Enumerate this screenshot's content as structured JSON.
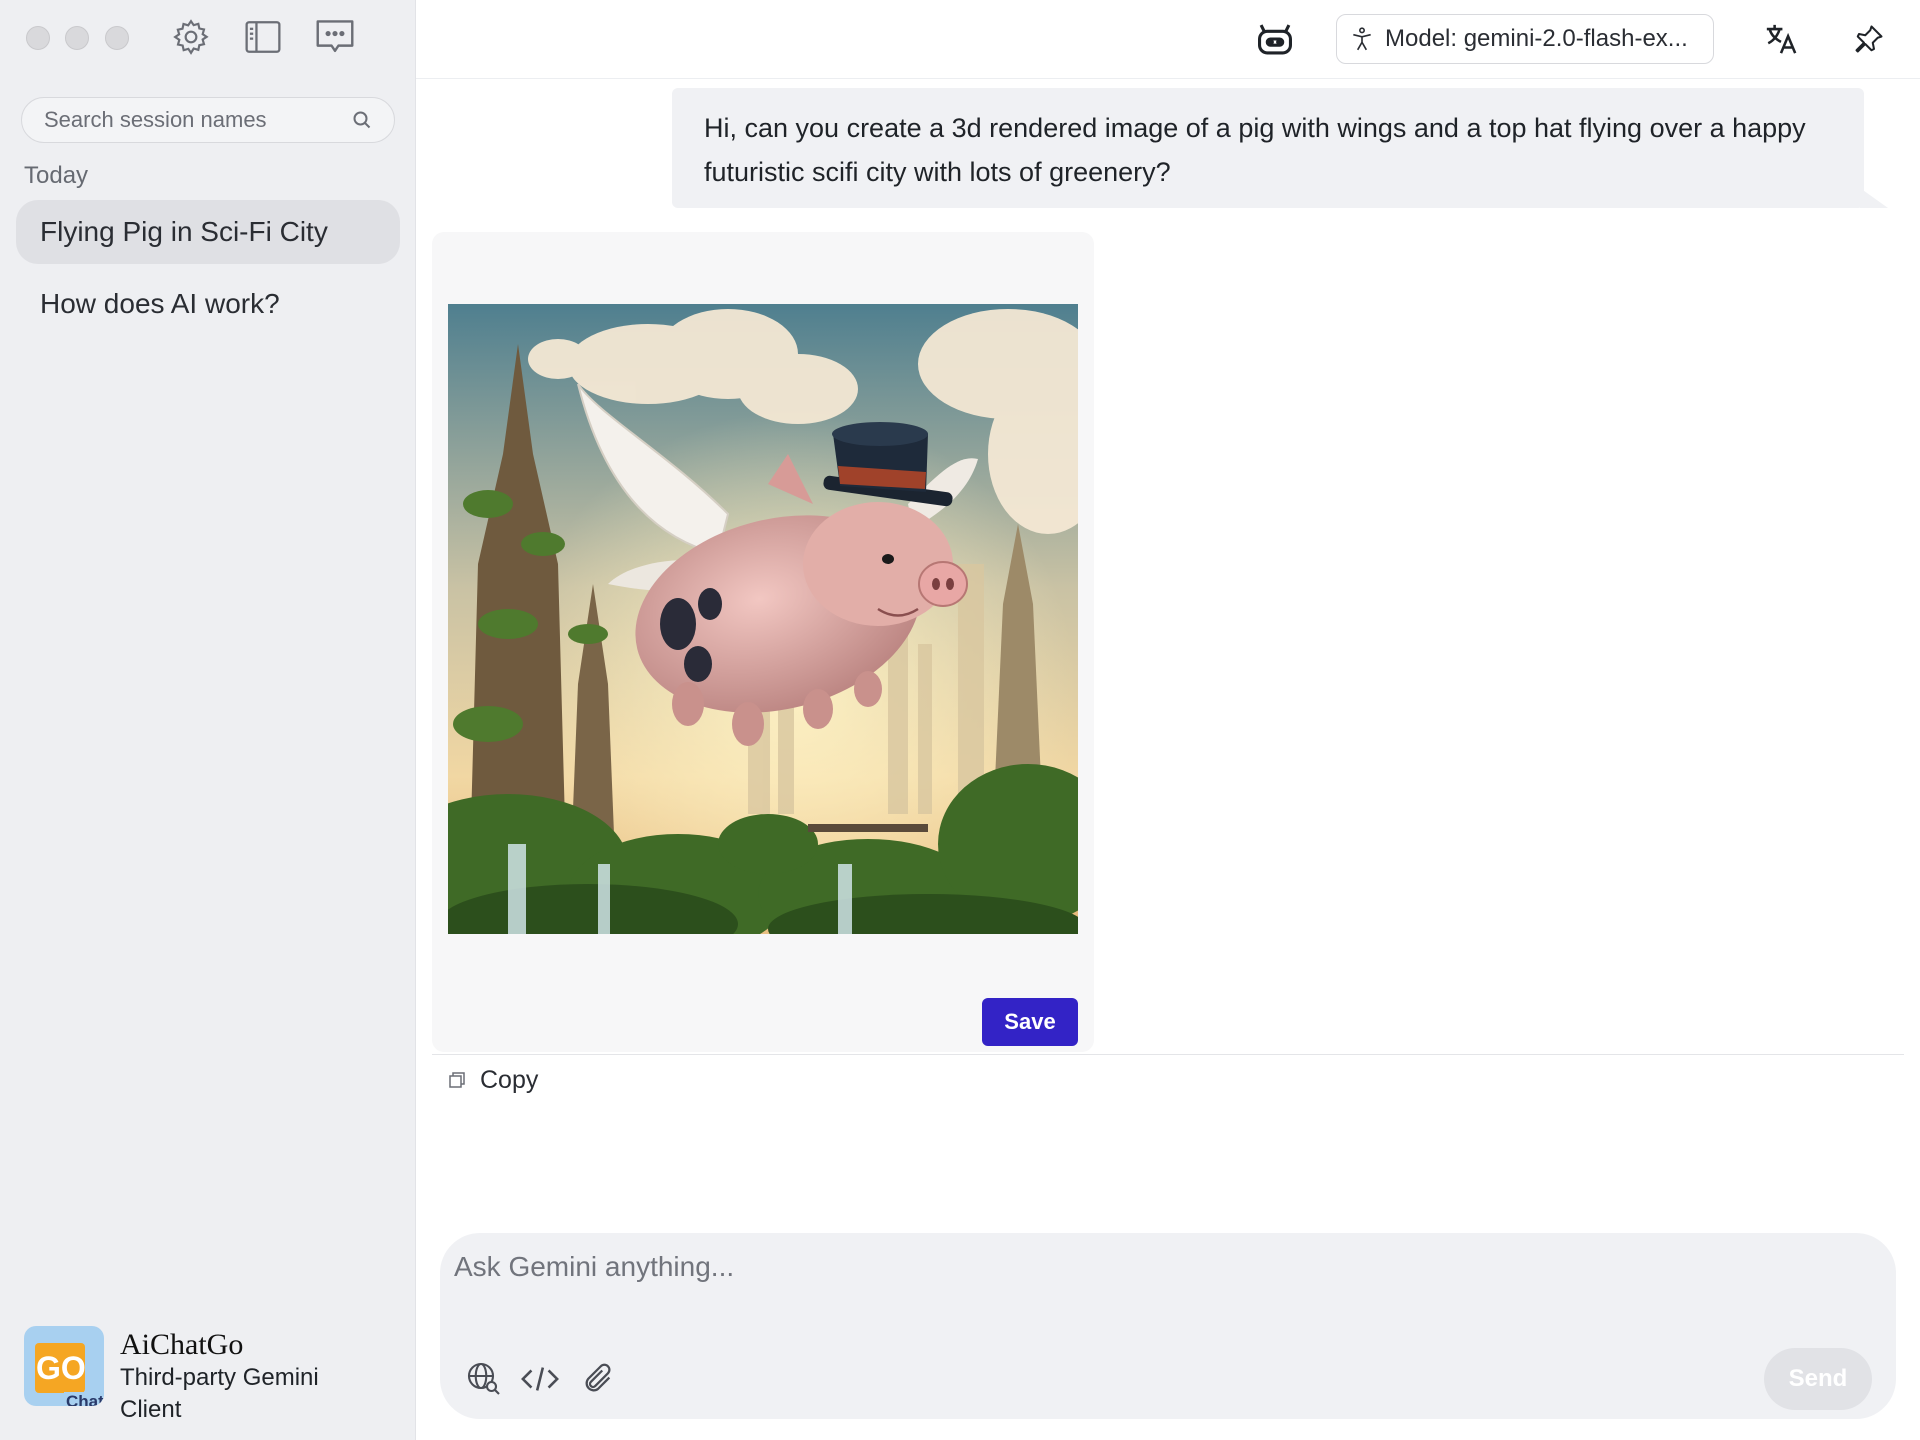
{
  "sidebar": {
    "search_placeholder": "Search session names",
    "section_today": "Today",
    "sessions": [
      {
        "label": "Flying Pig in Sci-Fi City",
        "active": true
      },
      {
        "label": "How does AI work?",
        "active": false
      }
    ],
    "brand": {
      "name": "AiChatGo",
      "subtitle": "Third-party Gemini Client",
      "logo_text": "GO",
      "logo_subtext": "Chat"
    }
  },
  "topbar": {
    "model_label": "Model: gemini-2.0-flash-ex..."
  },
  "chat": {
    "user_message": "Hi, can you create a 3d rendered image of a pig with wings and a top hat flying over a happy futuristic scifi city with lots of greenery?",
    "save_label": "Save",
    "copy_label": "Copy"
  },
  "composer": {
    "placeholder": "Ask Gemini anything...",
    "send_label": "Send"
  },
  "colors": {
    "accent": "#3323c6",
    "sidebar_bg": "#eeeff2",
    "bubble_bg": "#f0f1f4"
  },
  "icons": [
    "settings-icon",
    "sidebar-toggle-icon",
    "new-chat-icon",
    "search-icon",
    "bot-icon",
    "accessibility-icon",
    "translate-icon",
    "pin-icon",
    "copy-icon",
    "globe-search-icon",
    "code-icon",
    "paperclip-icon"
  ]
}
